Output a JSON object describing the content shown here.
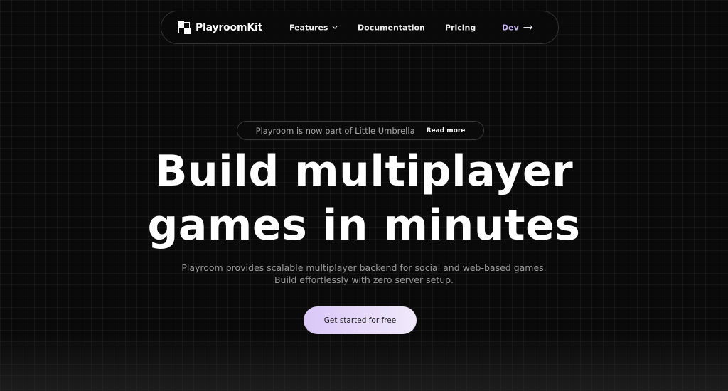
{
  "nav": {
    "brand": "PlayroomKit",
    "brand_icon": "checker-logo-icon",
    "items": [
      {
        "label": "Features",
        "icon": "chevron-down-icon"
      },
      {
        "label": "Documentation"
      },
      {
        "label": "Pricing"
      },
      {
        "label": "Dev",
        "icon": "arrow-right-icon"
      }
    ]
  },
  "announcement": {
    "text": "Playroom is now part of Little Umbrella",
    "link": "Read more"
  },
  "hero": {
    "headline_line1": "Build multiplayer",
    "headline_line2": "games in minutes",
    "subtitle_line1": "Playroom provides scalable multiplayer backend for social and web-based games.",
    "subtitle_line2": "Build effortlessly with zero server setup.",
    "cta": "Get started for free"
  },
  "colors": {
    "background": "#0a0a0a",
    "accent": "#d9c6f7",
    "dev_link": "#c9b6f0"
  }
}
